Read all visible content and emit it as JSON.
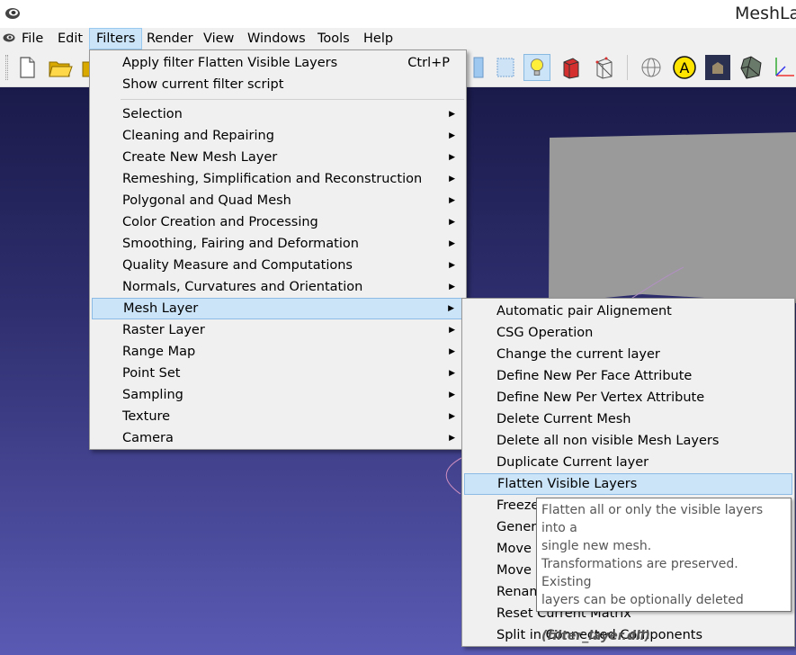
{
  "window": {
    "title": "MeshLab"
  },
  "menubar": [
    {
      "label": "File"
    },
    {
      "label": "Edit"
    },
    {
      "label": "Filters",
      "active": true
    },
    {
      "label": "Render"
    },
    {
      "label": "View"
    },
    {
      "label": "Windows"
    },
    {
      "label": "Tools"
    },
    {
      "label": "Help"
    }
  ],
  "toolbar": {
    "icons": [
      "new-document-icon",
      "open-folder-icon",
      "open-project-icon",
      "mesh-layer-icon",
      "snapshot-icon",
      "light-bulb-icon",
      "box-render-icon",
      "wireframe-box-icon",
      "sphere-grid-icon",
      "annotation-a-icon",
      "building-icon",
      "polyhedron-icon",
      "axis-icon"
    ]
  },
  "filters_menu": {
    "top_items": [
      {
        "label": "Apply filter Flatten Visible Layers",
        "shortcut": "Ctrl+P"
      },
      {
        "label": "Show current filter script",
        "shortcut": ""
      }
    ],
    "items": [
      {
        "label": "Selection"
      },
      {
        "label": "Cleaning and Repairing"
      },
      {
        "label": "Create New Mesh Layer"
      },
      {
        "label": "Remeshing, Simplification and Reconstruction"
      },
      {
        "label": "Polygonal and Quad Mesh"
      },
      {
        "label": "Color Creation and Processing"
      },
      {
        "label": "Smoothing, Fairing and Deformation"
      },
      {
        "label": "Quality Measure and Computations"
      },
      {
        "label": "Normals, Curvatures and Orientation"
      },
      {
        "label": "Mesh Layer",
        "highlighted": true
      },
      {
        "label": "Raster Layer"
      },
      {
        "label": "Range Map"
      },
      {
        "label": "Point Set"
      },
      {
        "label": "Sampling"
      },
      {
        "label": "Texture"
      },
      {
        "label": "Camera"
      }
    ]
  },
  "mesh_layer_menu": {
    "items": [
      {
        "label": "Automatic pair Alignement"
      },
      {
        "label": "CSG Operation"
      },
      {
        "label": "Change the current layer"
      },
      {
        "label": "Define New Per Face Attribute"
      },
      {
        "label": "Define New Per Vertex Attribute"
      },
      {
        "label": "Delete Current Mesh"
      },
      {
        "label": "Delete all non visible Mesh Layers"
      },
      {
        "label": "Duplicate Current layer"
      },
      {
        "label": "Flatten Visible Layers",
        "highlighted": true
      },
      {
        "label": "Freeze"
      },
      {
        "label": "Genera"
      },
      {
        "label": "Move s"
      },
      {
        "label": "Move s"
      },
      {
        "label": "Renam"
      },
      {
        "label": "Reset Current Matrix"
      },
      {
        "label": "Split in Connected Components"
      }
    ]
  },
  "tooltip": {
    "lines": [
      "Flatten all or only the visible layers into a",
      "single new mesh.",
      "Transformations are preserved. Existing",
      "layers can be optionally deleted"
    ],
    "dll": "(filter_layer.dll)"
  },
  "colors": {
    "menu_bg": "#f0f0f0",
    "highlight_bg": "#cce4f7",
    "highlight_border": "#8cbce6",
    "viewport_top": "#1a1a4a",
    "viewport_bottom": "#5a5ab4",
    "mesh_gray": "#9a9a9a"
  }
}
